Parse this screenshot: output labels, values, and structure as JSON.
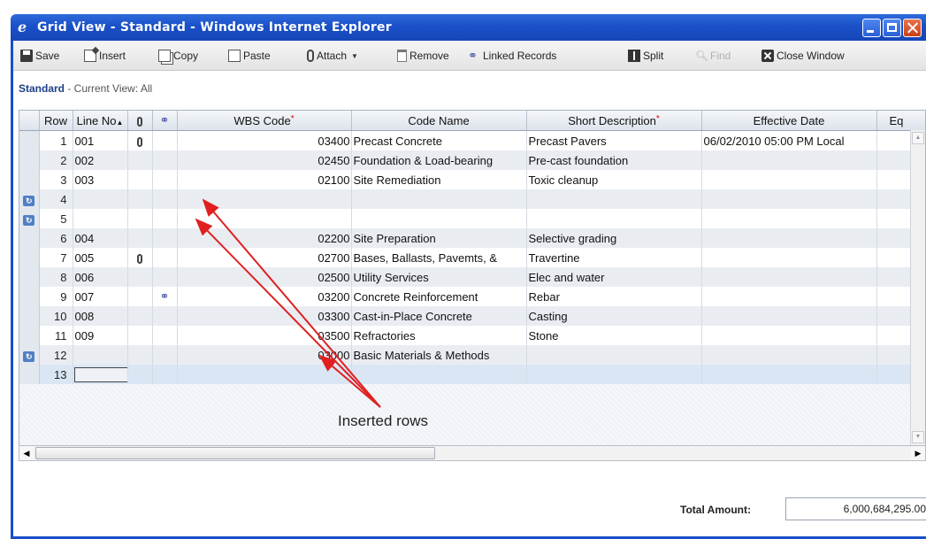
{
  "window": {
    "title": "Grid View - Standard - Windows Internet Explorer"
  },
  "toolbar": {
    "save": "Save",
    "insert": "Insert",
    "copy": "Copy",
    "paste": "Paste",
    "attach": "Attach",
    "remove": "Remove",
    "linked_records": "Linked Records",
    "split": "Split",
    "find": "Find",
    "close_window": "Close Window"
  },
  "view": {
    "name": "Standard",
    "label": " - Current View:  All"
  },
  "grid": {
    "columns": {
      "row": "Row",
      "line_no": "Line No",
      "wbs_code": "WBS Code",
      "code_name": "Code Name",
      "short_description": "Short Description",
      "effective_date": "Effective Date",
      "eq": "Eq"
    },
    "rows": [
      {
        "row": "1",
        "line_no": "001",
        "attach": true,
        "link": false,
        "inserted": false,
        "wbs": "03400",
        "code_name": "Precast Concrete",
        "desc": "Precast Pavers",
        "date": "06/02/2010 05:00 PM Local"
      },
      {
        "row": "2",
        "line_no": "002",
        "attach": false,
        "link": false,
        "inserted": false,
        "wbs": "02450",
        "code_name": "Foundation & Load-bearing",
        "desc": "Pre-cast foundation",
        "date": ""
      },
      {
        "row": "3",
        "line_no": "003",
        "attach": false,
        "link": false,
        "inserted": false,
        "wbs": "02100",
        "code_name": "Site Remediation",
        "desc": "Toxic cleanup",
        "date": ""
      },
      {
        "row": "4",
        "line_no": "",
        "attach": false,
        "link": false,
        "inserted": true,
        "wbs": "",
        "code_name": "",
        "desc": "",
        "date": ""
      },
      {
        "row": "5",
        "line_no": "",
        "attach": false,
        "link": false,
        "inserted": true,
        "wbs": "",
        "code_name": "",
        "desc": "",
        "date": ""
      },
      {
        "row": "6",
        "line_no": "004",
        "attach": false,
        "link": false,
        "inserted": false,
        "wbs": "02200",
        "code_name": "Site Preparation",
        "desc": "Selective grading",
        "date": ""
      },
      {
        "row": "7",
        "line_no": "005",
        "attach": true,
        "link": false,
        "inserted": false,
        "wbs": "02700",
        "code_name": "Bases, Ballasts, Pavemts, &",
        "desc": "Travertine",
        "date": ""
      },
      {
        "row": "8",
        "line_no": "006",
        "attach": false,
        "link": false,
        "inserted": false,
        "wbs": "02500",
        "code_name": "Utility Services",
        "desc": "Elec and water",
        "date": ""
      },
      {
        "row": "9",
        "line_no": "007",
        "attach": false,
        "link": true,
        "inserted": false,
        "wbs": "03200",
        "code_name": "Concrete Reinforcement",
        "desc": "Rebar",
        "date": ""
      },
      {
        "row": "10",
        "line_no": "008",
        "attach": false,
        "link": false,
        "inserted": false,
        "wbs": "03300",
        "code_name": "Cast-in-Place Concrete",
        "desc": "Casting",
        "date": ""
      },
      {
        "row": "11",
        "line_no": "009",
        "attach": false,
        "link": false,
        "inserted": false,
        "wbs": "03500",
        "code_name": "Refractories",
        "desc": "Stone",
        "date": ""
      },
      {
        "row": "12",
        "line_no": "",
        "attach": false,
        "link": false,
        "inserted": true,
        "wbs": "03000",
        "code_name": "Basic Materials & Methods",
        "desc": "",
        "date": ""
      },
      {
        "row": "13",
        "line_no": "",
        "attach": false,
        "link": false,
        "inserted": false,
        "wbs": "",
        "code_name": "",
        "desc": "",
        "date": "",
        "selected": true
      }
    ]
  },
  "footer": {
    "total_label": "Total Amount:",
    "total_value": "6,000,684,295.00"
  },
  "annotation": {
    "text": "Inserted rows",
    "color": "#e02020"
  }
}
